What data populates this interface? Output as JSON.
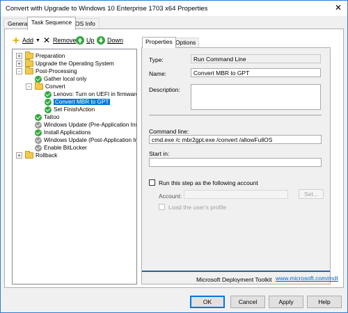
{
  "window": {
    "title": "Convert with Upgrade to Windows 10 Enterprise 1703 x64 Properties"
  },
  "tabs": [
    {
      "label": "General"
    },
    {
      "label": "Task Sequence"
    },
    {
      "label": "OS Info"
    }
  ],
  "toolbar": {
    "add": "Add",
    "remove": "Remove",
    "up": "Up",
    "down": "Down"
  },
  "tree": {
    "items": [
      {
        "label": "Preparation",
        "icon": "folder-icon",
        "expander": "+"
      },
      {
        "label": "Upgrade the Operating System",
        "icon": "folder-icon",
        "expander": "+"
      },
      {
        "label": "Post-Processing",
        "icon": "folder-icon",
        "expander": "-"
      },
      {
        "label": "Gather local only",
        "icon": "check-icon"
      },
      {
        "label": "Convert",
        "icon": "folder-icon",
        "expander": "-"
      },
      {
        "label": "Lenovo: Turn on UEFI in firmware",
        "icon": "check-icon"
      },
      {
        "label": "Convert MBR to GPT",
        "icon": "check-icon",
        "selected": true
      },
      {
        "label": "Set FinishAction",
        "icon": "check-icon"
      },
      {
        "label": "Tattoo",
        "icon": "check-icon"
      },
      {
        "label": "Windows Update (Pre-Application Installation)",
        "icon": "gray-check-icon"
      },
      {
        "label": "Install Applications",
        "icon": "check-icon"
      },
      {
        "label": "Windows Update (Post-Application Installation)",
        "icon": "gray-check-icon"
      },
      {
        "label": "Enable BitLocker",
        "icon": "gray-check-icon"
      },
      {
        "label": "Rollback",
        "icon": "folder-icon",
        "expander": "+"
      }
    ]
  },
  "properties": {
    "tabs": [
      {
        "label": "Properties"
      },
      {
        "label": "Options"
      }
    ],
    "type_label": "Type:",
    "type_value": "Run Command Line",
    "name_label": "Name:",
    "name_value": "Convert MBR to GPT",
    "description_label": "Description:",
    "description_value": "",
    "command_label": "Command line:",
    "command_value": "cmd.exe /c mbr2gpt.exe /convert /allowFullOS",
    "startin_label": "Start in:",
    "startin_value": "",
    "run_as_label": "Run this step as the following account",
    "account_label": "Account:",
    "account_value": "",
    "set_button": "Set...",
    "load_profile_label": "Load the user's profile",
    "footer_text": "Microsoft Deployment Toolkit",
    "footer_link": "www.microsoft.com/mdt"
  },
  "buttons": {
    "ok": "OK",
    "cancel": "Cancel",
    "apply": "Apply",
    "help": "Help"
  },
  "colors": {
    "accent": "#0078d7",
    "success": "#31a83c",
    "disabled": "#9a9a9a",
    "link": "#0066cc"
  }
}
